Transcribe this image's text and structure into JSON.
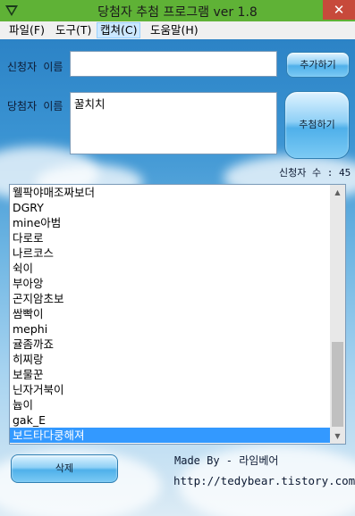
{
  "window": {
    "title": "당첨자 추첨 프로그램 ver 1.8",
    "close_glyph": "✕",
    "icon": "app-icon"
  },
  "menu": [
    "파일(F)",
    "도구(T)",
    "캡쳐(C)",
    "도움말(H)"
  ],
  "form": {
    "applicant_label": "신청자 이름",
    "applicant_value": "",
    "add_button": "추가하기",
    "winner_label": "당첨자 이름",
    "winner_value": "꿀치치",
    "draw_button": "추첨하기",
    "count_label": "신청자 수 : 45"
  },
  "list": {
    "items": [
      "웰팍야매조짜보더",
      "DGRY",
      "mine아범",
      "다로로",
      "나르코스",
      "쉭이",
      "부아앙",
      "곤지암초보",
      "쌈빡이",
      "mephi",
      "귤좀까죠",
      "히찌랑",
      "보물꾼",
      "닌자거북이",
      "늅이",
      "gak_E",
      "보드타다쿵해져"
    ],
    "selected": 16
  },
  "footer": {
    "delete_button": "삭제",
    "made_by": "Made By - 라임베어",
    "url": "http://tedybear.tistory.com"
  },
  "colors": {
    "titlebar": "#5fb236",
    "close": "#c74a3b",
    "selection": "#3399ff"
  }
}
